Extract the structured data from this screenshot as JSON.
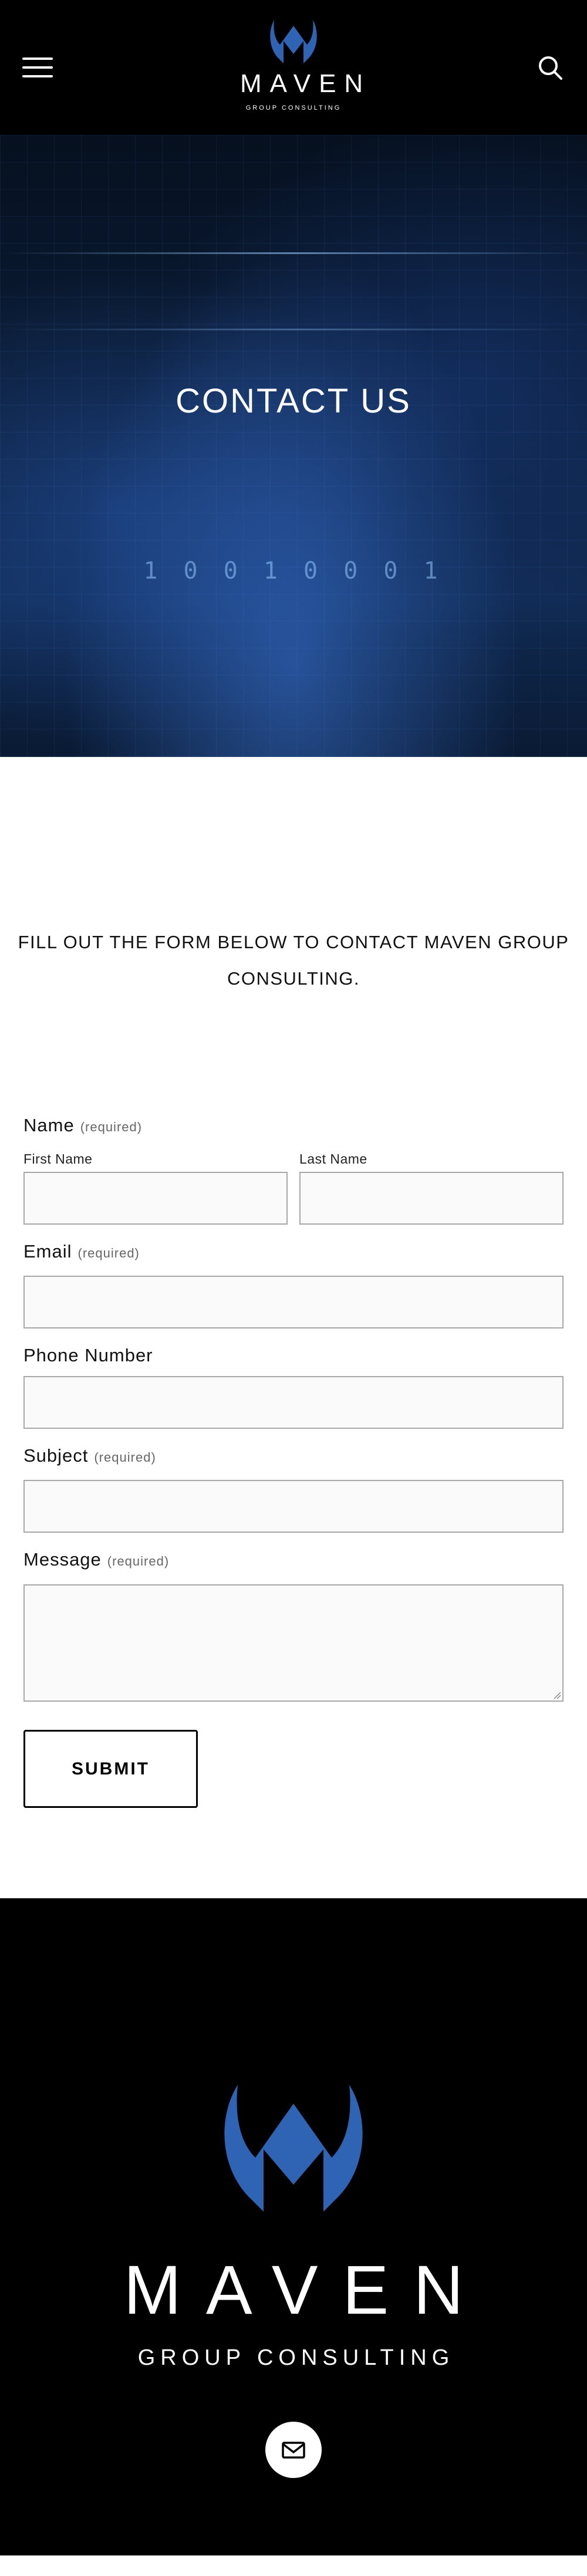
{
  "header": {
    "logo_text": "MAVEN",
    "logo_subtext": "GROUP CONSULTING",
    "menu_icon": "hamburger-menu-icon",
    "search_icon": "search-icon",
    "background": "#000000"
  },
  "hero": {
    "title": "CONTACT US",
    "binary_decoration": "1 0 0 1 0 0 0 1"
  },
  "intro": {
    "text": "FILL OUT THE FORM BELOW TO CONTACT MAVEN GROUP CONSULTING."
  },
  "form": {
    "name": {
      "label": "Name",
      "required": "(required)",
      "first_label": "First Name",
      "first_value": "",
      "last_label": "Last Name",
      "last_value": ""
    },
    "email": {
      "label": "Email",
      "required": "(required)",
      "value": ""
    },
    "phone": {
      "label": "Phone Number",
      "value": ""
    },
    "subject": {
      "label": "Subject",
      "required": "(required)",
      "value": ""
    },
    "message": {
      "label": "Message",
      "required": "(required)",
      "value": ""
    },
    "submit_label": "SUBMIT"
  },
  "footer": {
    "logo_text": "MAVEN",
    "logo_subtext": "GROUP CONSULTING",
    "mail_icon": "mail-icon",
    "background": "#000000"
  },
  "colors": {
    "brand_blue": "#2f64b4",
    "field_border": "#a8a8a8",
    "field_bg": "#fafafa"
  }
}
